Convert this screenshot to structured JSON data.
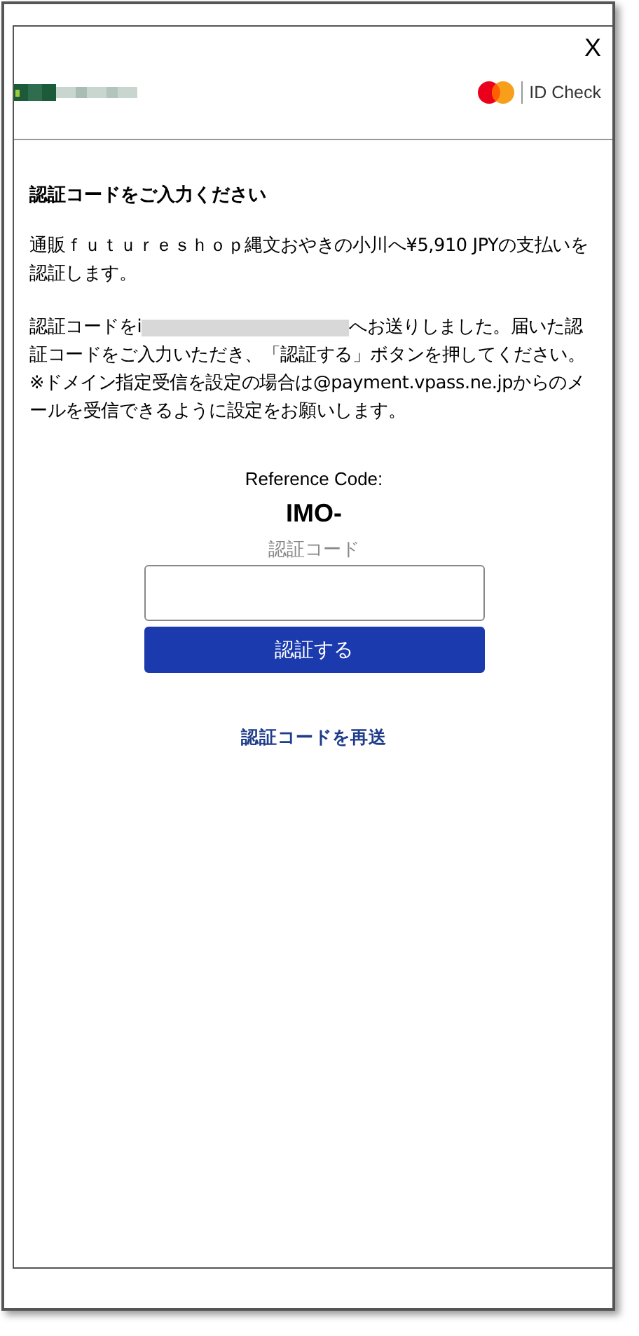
{
  "close": "X",
  "brand": {
    "logo_text": "ID Check"
  },
  "title": "認証コードをご入力ください",
  "paragraphs": [
    {
      "before": "通販ｆｕｔｕｒｅｓｈｏｐ縄文おやきの小川へ¥5,910 JPYの支払いを認証します。"
    },
    {
      "before": "認証コードをi",
      "redacted": true,
      "after": "へお送りしました。届いた認証コードをご入力いただき、「認証する」ボタンを押してください。"
    }
  ],
  "notice": "※ドメイン指定受信を設定の場合は@payment.vpass.ne.jpからのメールを受信できるように設定をお願いします。",
  "reference_label": "Reference Code:",
  "reference_code": "IMO-",
  "code_field": {
    "label": "認証コード"
  },
  "submit_button": "認証する",
  "resend_link": "認証コードを再送"
}
